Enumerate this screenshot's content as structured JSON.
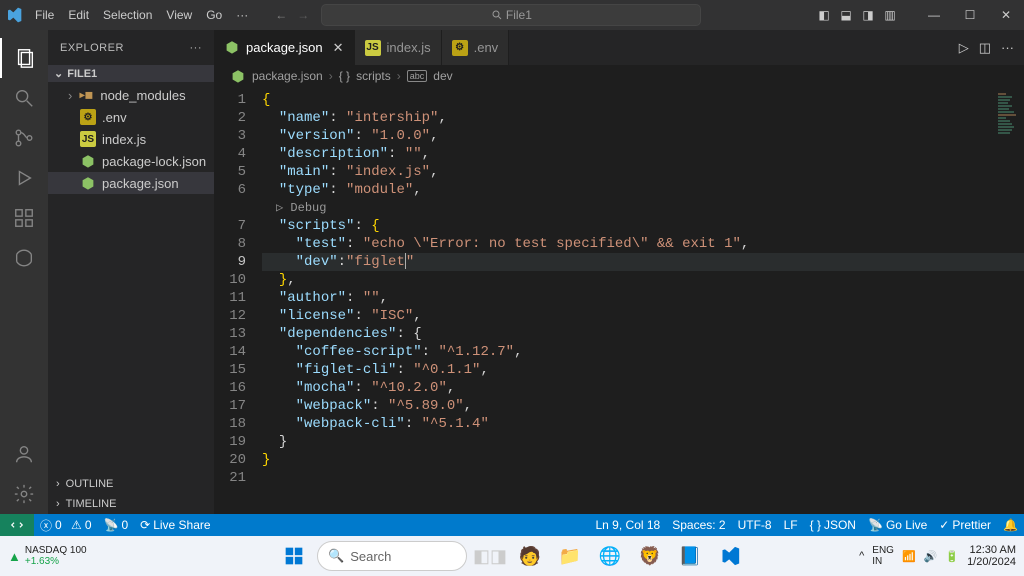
{
  "titlebar": {
    "menu": [
      "File",
      "Edit",
      "Selection",
      "View",
      "Go"
    ],
    "search_label": "File1"
  },
  "sidebar": {
    "header": "EXPLORER",
    "project": "FILE1",
    "files": [
      {
        "name": "node_modules",
        "type": "folder"
      },
      {
        "name": ".env",
        "type": "env"
      },
      {
        "name": "index.js",
        "type": "js"
      },
      {
        "name": "package-lock.json",
        "type": "npm"
      },
      {
        "name": "package.json",
        "type": "npm",
        "selected": true
      }
    ],
    "outline": "OUTLINE",
    "timeline": "TIMELINE"
  },
  "tabs": [
    {
      "label": "package.json",
      "icon": "npm",
      "active": true,
      "close": true
    },
    {
      "label": "index.js",
      "icon": "js",
      "active": false
    },
    {
      "label": ".env",
      "icon": "env",
      "active": false
    }
  ],
  "breadcrumb": [
    "package.json",
    "scripts",
    "dev"
  ],
  "code": {
    "lines": 21,
    "current_line": 9,
    "codelens": "Debug",
    "content": {
      "name": "intership",
      "version": "1.0.0",
      "description": "",
      "main": "index.js",
      "type": "module",
      "scripts": {
        "test": "echo \\\"Error: no test specified\\\" && exit 1",
        "dev": "figlet"
      },
      "author": "",
      "license": "ISC",
      "dependencies": {
        "coffee-script": "^1.12.7",
        "figlet-cli": "^0.1.1",
        "mocha": "^10.2.0",
        "webpack": "^5.89.0",
        "webpack-cli": "^5.1.4"
      }
    }
  },
  "statusbar": {
    "errors": "0",
    "warnings": "0",
    "ports": "0",
    "liveshare": "Live Share",
    "cursor": "Ln 9, Col 18",
    "spaces": "Spaces: 2",
    "encoding": "UTF-8",
    "eol": "LF",
    "lang": "JSON",
    "golive": "Go Live",
    "prettier": "Prettier"
  },
  "taskbar": {
    "ticker_name": "NASDAQ 100",
    "ticker_change": "+1.63%",
    "search_placeholder": "Search",
    "time": "12:30 AM",
    "date": "1/20/2024"
  }
}
